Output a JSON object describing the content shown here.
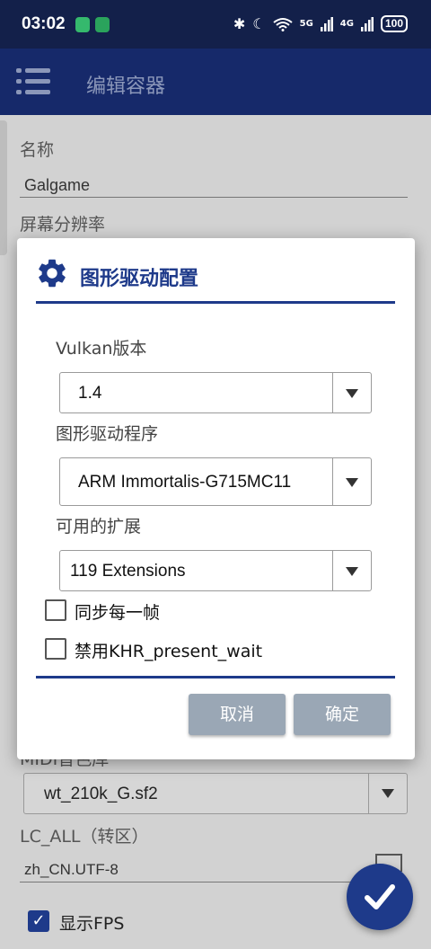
{
  "status_bar": {
    "time": "03:02",
    "signal_1": "5G",
    "signal_2": "4G",
    "battery": "100"
  },
  "app_bar": {
    "title": "编辑容器"
  },
  "background_form": {
    "name_label": "名称",
    "name_value": "Galgame",
    "resolution_label": "屏幕分辨率",
    "midi_label": "MIDI音色库",
    "midi_value": "wt_210k_G.sf2",
    "lc_all_label": "LC_ALL（转区）",
    "lc_all_value": "zh_CN.UTF-8",
    "show_fps_label": "显示FPS",
    "show_fps_checked": true
  },
  "dialog": {
    "title": "图形驱动配置",
    "vulkan_label": "Vulkan版本",
    "vulkan_value": "1.4",
    "driver_label": "图形驱动程序",
    "driver_value": "ARM Immortalis-G715MC11",
    "extensions_label": "可用的扩展",
    "extensions_value": "119 Extensions",
    "sync_label": "同步每一帧",
    "sync_checked": false,
    "disable_khr_label": "禁用KHR_present_wait",
    "disable_khr_checked": false,
    "cancel_label": "取消",
    "ok_label": "确定"
  },
  "colors": {
    "accent": "#1e3a8a",
    "status_bar": "#13204a",
    "app_bar": "#16296a",
    "button": "#9aa7b5"
  }
}
